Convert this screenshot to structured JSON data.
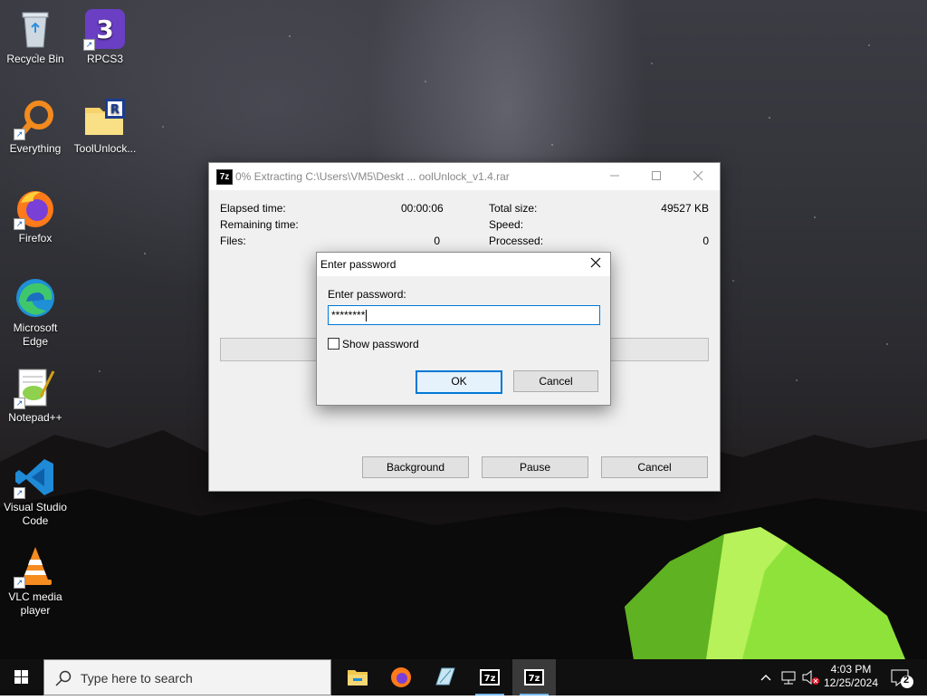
{
  "desktop": {
    "icons": [
      {
        "label": "Recycle Bin"
      },
      {
        "label": "RPCS3"
      },
      {
        "label": "Everything"
      },
      {
        "label": "ToolUnlock..."
      },
      {
        "label": "Firefox"
      },
      {
        "label": "Microsoft Edge"
      },
      {
        "label": "Notepad++"
      },
      {
        "label": "Visual Studio Code"
      },
      {
        "label": "VLC media player"
      }
    ]
  },
  "extract_window": {
    "icon_text": "7z",
    "title": "0% Extracting C:\\Users\\VM5\\Deskt ... oolUnlock_v1.4.rar",
    "elapsed_label": "Elapsed time:",
    "elapsed_value": "00:00:06",
    "remaining_label": "Remaining time:",
    "files_label": "Files:",
    "files_value": "0",
    "total_label": "Total size:",
    "total_value": "49527 KB",
    "speed_label": "Speed:",
    "processed_label": "Processed:",
    "processed_value": "0",
    "progress": 0,
    "buttons": {
      "background": "Background",
      "pause": "Pause",
      "cancel": "Cancel"
    }
  },
  "password_dialog": {
    "title": "Enter password",
    "prompt": "Enter password:",
    "value": "********",
    "show_password": "Show password",
    "show_password_checked": false,
    "ok": "OK",
    "cancel": "Cancel"
  },
  "taskbar": {
    "search_placeholder": "Type here to search",
    "apps": [
      "file-explorer",
      "firefox",
      "notepad-plus-plus",
      "7-zip",
      "7-zip"
    ],
    "active_app": 4,
    "pinned_icon_text": "7z",
    "time": "4:03 PM",
    "date": "12/25/2024",
    "notification_count": "2"
  },
  "colors": {
    "accent": "#0078d7",
    "taskbar": "#101010",
    "tent": "#7fdc2a"
  }
}
